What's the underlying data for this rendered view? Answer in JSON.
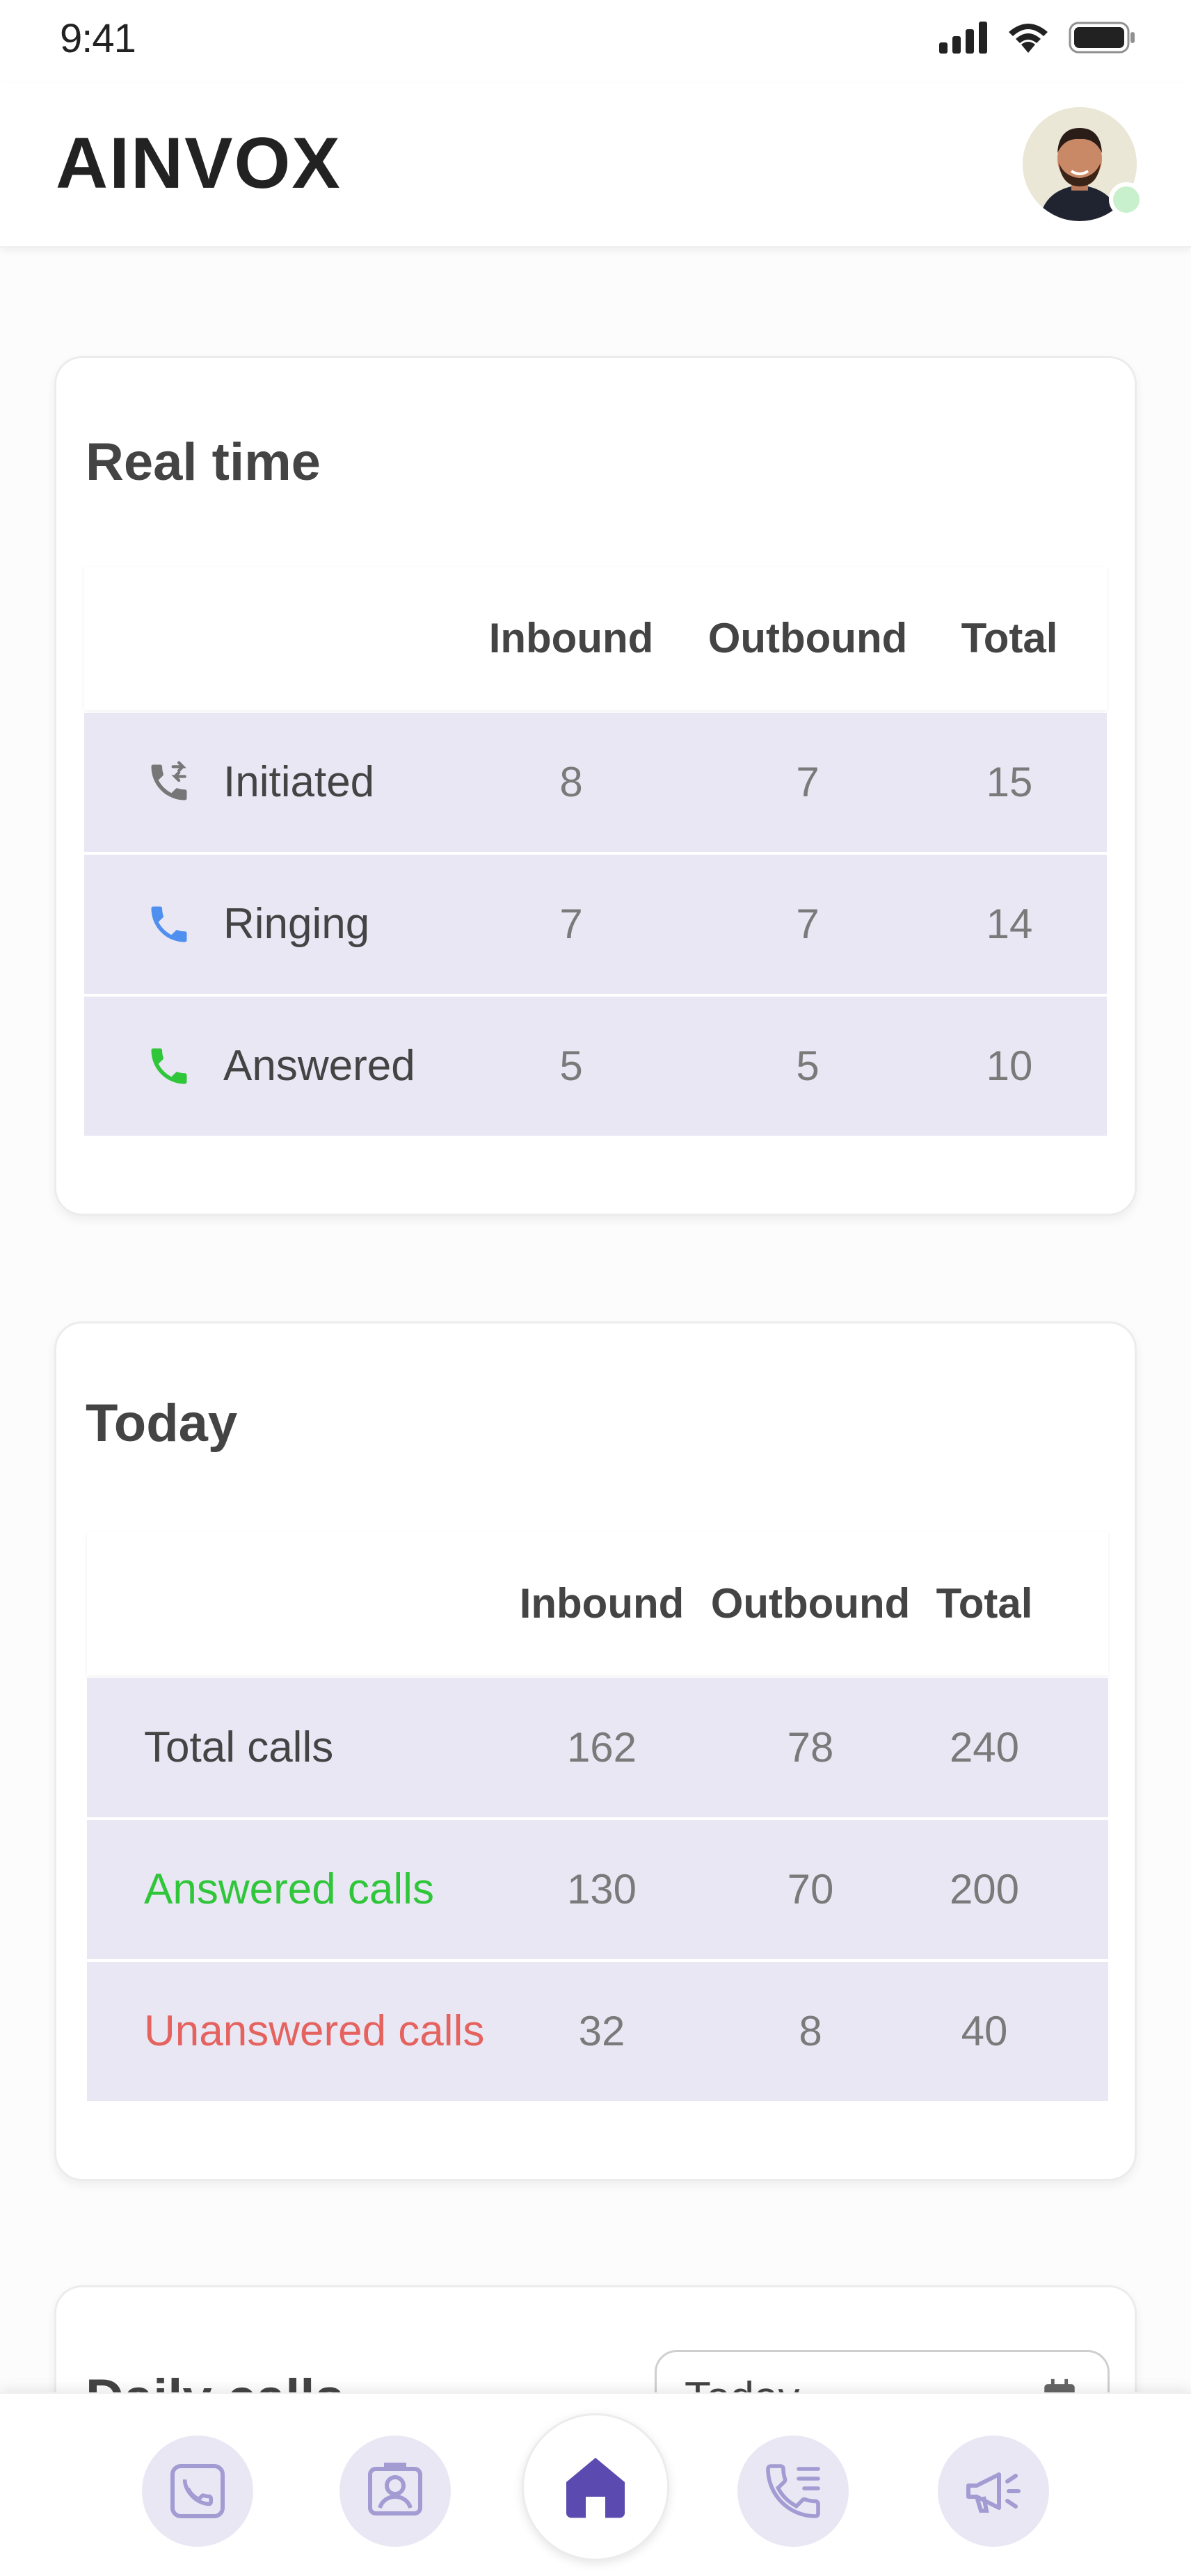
{
  "status_bar": {
    "time": "9:41"
  },
  "header": {
    "title": "AINVOX"
  },
  "realtime": {
    "title": "Real time",
    "columns": [
      "Inbound",
      "Outbound",
      "Total"
    ],
    "rows": [
      {
        "label": "Initiated",
        "icon": "phone-transfer-icon",
        "inbound": "8",
        "outbound": "7",
        "total": "15"
      },
      {
        "label": "Ringing",
        "icon": "phone-ringing-icon",
        "inbound": "7",
        "outbound": "7",
        "total": "14"
      },
      {
        "label": "Answered",
        "icon": "phone-answered-icon",
        "inbound": "5",
        "outbound": "5",
        "total": "10"
      }
    ]
  },
  "today": {
    "title": "Today",
    "columns": [
      "Inbound",
      "Outbound",
      "Total"
    ],
    "rows": [
      {
        "label": "Total calls",
        "inbound": "162",
        "outbound": "78",
        "total": "240"
      },
      {
        "label": "Answered calls",
        "inbound": "130",
        "outbound": "70",
        "total": "200"
      },
      {
        "label": "Unanswered calls",
        "inbound": "32",
        "outbound": "8",
        "total": "40"
      }
    ]
  },
  "daily_calls": {
    "title": "Daily calls",
    "date_select_value": "Today"
  },
  "bottom_nav": {
    "items": [
      "call-log-icon",
      "contacts-icon",
      "home-icon",
      "call-list-icon",
      "campaign-icon"
    ],
    "active": "home-icon"
  },
  "colors": {
    "accent": "#5b4bb0",
    "row_bg": "#e9e7f4",
    "answered_green": "#2fc63a",
    "unanswered_red": "#e5635f",
    "ringing_blue": "#4f8ff0"
  }
}
